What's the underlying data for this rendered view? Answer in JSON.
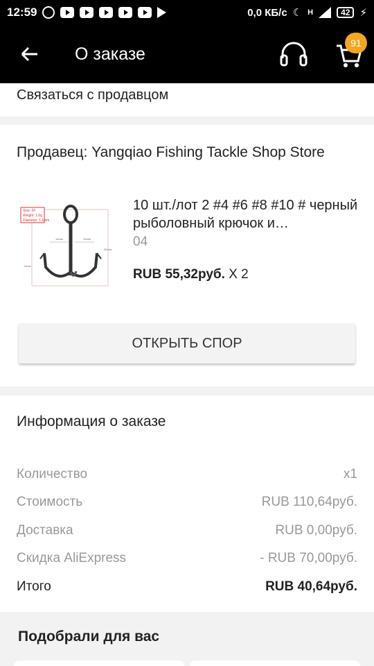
{
  "status": {
    "time": "12:59",
    "speed": "0,0 КБ/с",
    "signal": "H",
    "battery": "42"
  },
  "header": {
    "title": "О заказе",
    "cart_count": "91"
  },
  "contact": {
    "label": "Связаться с продавцом"
  },
  "seller": {
    "label": "Продавец: Yangqiao Fishing Tackle Shop Store"
  },
  "product": {
    "title": "10 шт./лот 2 #4 #6 #8 #10 # черный рыболовный крючок и…",
    "variant": "04",
    "price": "RUB 55,32руб.",
    "qty": "X 2",
    "image_labels": {
      "size": "Size: 2#",
      "weight": "Weight: 1.0g",
      "diameter": "Diameter: 1.1mm",
      "d1": "10mm",
      "d2": "10mm",
      "d3": "20mm",
      "d4": "13mm"
    }
  },
  "actions": {
    "dispute": "ОТКРЫТЬ СПОР"
  },
  "order_info": {
    "title": "Информация о заказе",
    "rows": [
      {
        "label": "Количество",
        "value": "x1"
      },
      {
        "label": "Стоимость",
        "value": "RUB 110,64руб."
      },
      {
        "label": "Доставка",
        "value": "RUB 0,00руб."
      },
      {
        "label": "Скидка AliExpress",
        "value": "- RUB 70,00руб."
      },
      {
        "label": "Итого",
        "value": "RUB 40,64руб."
      }
    ]
  },
  "recommendations": {
    "title": "Подобрали для вас"
  },
  "colors": {
    "bar": "#000000",
    "badge": "#f5a623",
    "muted": "#999999"
  }
}
